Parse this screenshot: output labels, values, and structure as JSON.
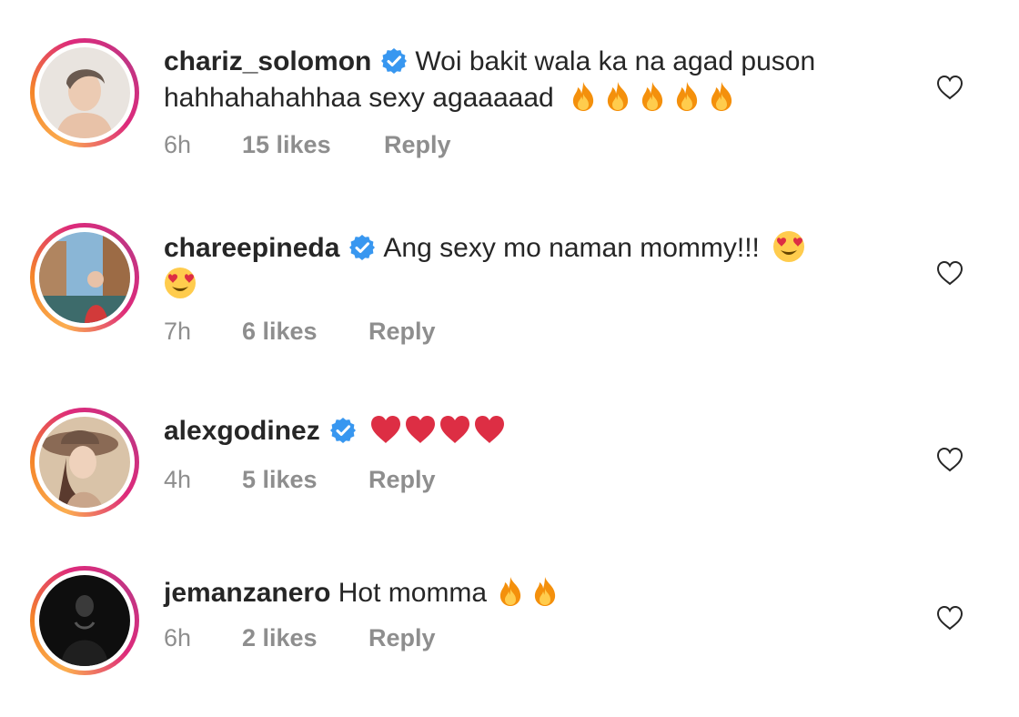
{
  "comments": [
    {
      "username": "chariz_solomon",
      "verified": true,
      "text_line1": "Woi bakit wala ka na agad puson",
      "text_line2": "hahhahahahhaa sexy agaaaaad",
      "emojis": [
        "fire-emoji",
        "fire-emoji",
        "fire-emoji",
        "fire-emoji",
        "fire-emoji"
      ],
      "time": "6h",
      "likes": "15 likes",
      "reply": "Reply"
    },
    {
      "username": "chareepineda",
      "verified": true,
      "text_line1": "Ang sexy mo naman mommy!!!",
      "emojis": [
        "heart-eyes-emoji",
        "heart-eyes-emoji"
      ],
      "time": "7h",
      "likes": "6 likes",
      "reply": "Reply"
    },
    {
      "username": "alexgodinez",
      "verified": true,
      "text_line1": "",
      "emojis": [
        "red-heart-emoji",
        "red-heart-emoji",
        "red-heart-emoji",
        "red-heart-emoji"
      ],
      "time": "4h",
      "likes": "5 likes",
      "reply": "Reply"
    },
    {
      "username": "jemanzanero",
      "verified": false,
      "text_line1": "Hot momma",
      "emojis": [
        "fire-emoji",
        "fire-emoji"
      ],
      "time": "6h",
      "likes": "2 likes",
      "reply": "Reply"
    }
  ],
  "colors": {
    "text": "#262626",
    "meta": "#8e8e8e",
    "verified": "#3897f0",
    "ring_start": "#fbad50",
    "ring_end": "#c13584"
  },
  "icons": {
    "verified": "verified-badge-icon",
    "like": "heart-outline-icon"
  }
}
